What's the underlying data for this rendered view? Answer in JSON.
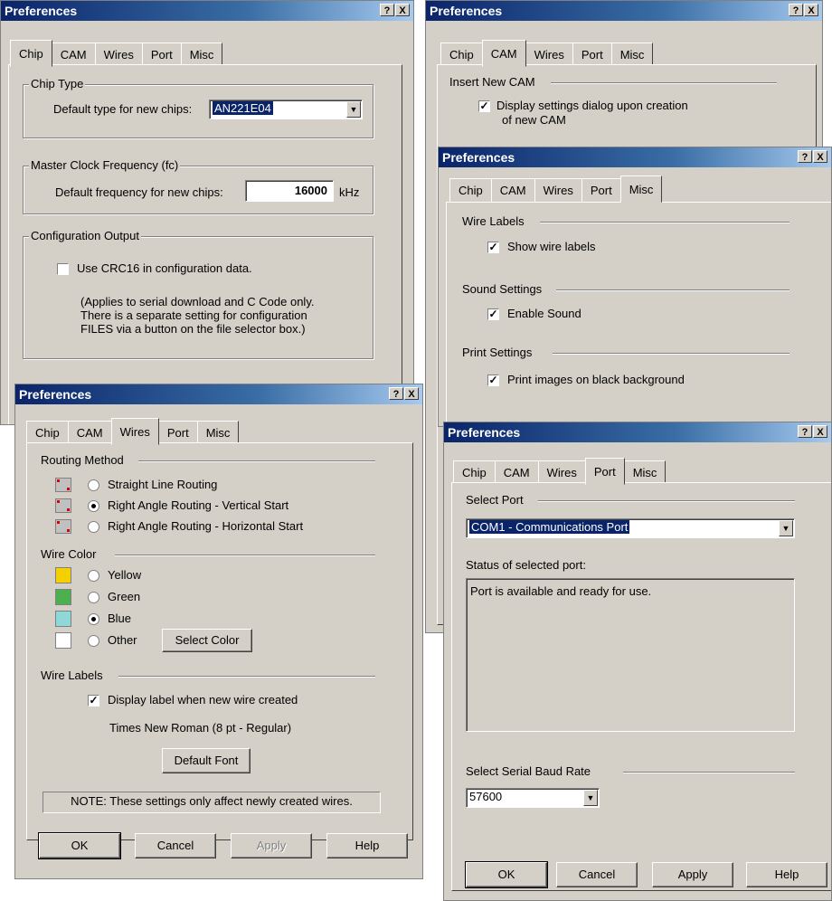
{
  "windows": {
    "chip": {
      "title": "Preferences",
      "tabs": [
        "Chip",
        "CAM",
        "Wires",
        "Port",
        "Misc"
      ],
      "chip_type_group": "Chip Type",
      "default_type_label": "Default type for new chips:",
      "default_type_value": "AN221E04",
      "clock_group": "Master Clock Frequency (fc)",
      "default_freq_label": "Default frequency for new chips:",
      "default_freq_value": "16000",
      "freq_unit": "kHz",
      "config_group": "Configuration Output",
      "crc_label": "Use CRC16 in configuration data.",
      "crc_note_1": "(Applies to serial download and C Code only.",
      "crc_note_2": "There is a separate setting for configuration",
      "crc_note_3": "FILES via a button on the file selector box.)"
    },
    "cam": {
      "title": "Preferences",
      "tabs": [
        "Chip",
        "CAM",
        "Wires",
        "Port",
        "Misc"
      ],
      "insert_section": "Insert New CAM",
      "display_settings_1": "Display settings dialog upon creation",
      "display_settings_2": "of new CAM"
    },
    "misc": {
      "title": "Preferences",
      "tabs": [
        "Chip",
        "CAM",
        "Wires",
        "Port",
        "Misc"
      ],
      "wire_labels_section": "Wire Labels",
      "show_wire_labels": "Show wire labels",
      "sound_section": "Sound Settings",
      "enable_sound": "Enable Sound",
      "print_section": "Print Settings",
      "print_black": "Print images on black background"
    },
    "wires": {
      "title": "Preferences",
      "tabs": [
        "Chip",
        "CAM",
        "Wires",
        "Port",
        "Misc"
      ],
      "routing_section": "Routing Method",
      "routing_options": [
        "Straight Line Routing",
        "Right Angle Routing - Vertical Start",
        "Right Angle Routing - Horizontal Start"
      ],
      "color_section": "Wire Color",
      "color_options": [
        "Yellow",
        "Green",
        "Blue",
        "Other"
      ],
      "swatch_colors": [
        "#f4d000",
        "#4caf50",
        "#8ed8d8",
        "#ffffff"
      ],
      "select_color": "Select Color",
      "labels_section": "Wire Labels",
      "display_label": "Display label when new wire created",
      "font_desc": "Times New Roman (8 pt - Regular)",
      "default_font": "Default Font",
      "note": "NOTE: These settings only affect newly created wires.",
      "buttons": [
        "OK",
        "Cancel",
        "Apply",
        "Help"
      ]
    },
    "port": {
      "title": "Preferences",
      "tabs": [
        "Chip",
        "CAM",
        "Wires",
        "Port",
        "Misc"
      ],
      "select_port_section": "Select Port",
      "port_value": "COM1 - Communications Port",
      "status_label": "Status of selected port:",
      "status_text": "Port is available and ready for use.",
      "baud_section": "Select Serial Baud Rate",
      "baud_value": "57600",
      "buttons": [
        "OK",
        "Cancel",
        "Apply",
        "Help"
      ]
    }
  },
  "title_buttons": {
    "help": "?",
    "close": "X"
  }
}
